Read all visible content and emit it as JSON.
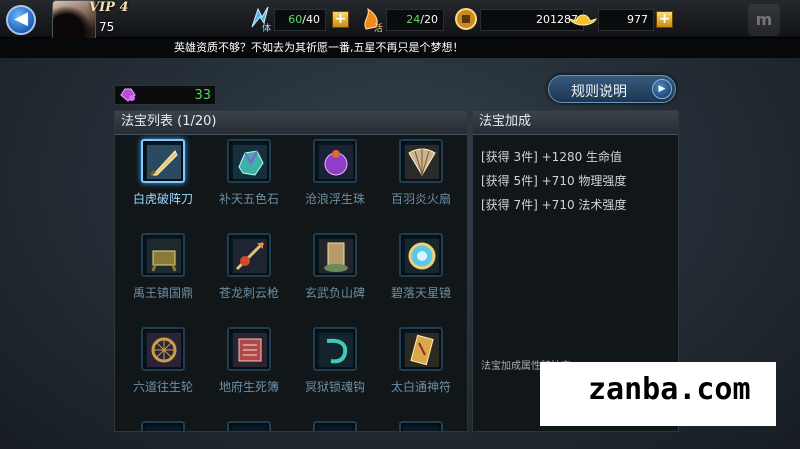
{
  "header": {
    "vip": "VIP 4",
    "level": "75",
    "stamina": {
      "current": "60",
      "max": "/40"
    },
    "energy": {
      "current": "24",
      "max": "/20"
    },
    "coins": "201287",
    "gold": "977",
    "plus": "+"
  },
  "marquee": "英雄资质不够？不如去为其祈愿一番,五星不再只是个梦想！",
  "gem_count": "33",
  "rules_label": "规则说明",
  "treasure_list": {
    "title": "法宝列表 (1/20)",
    "items": [
      {
        "name": "白虎破阵刀",
        "icon": "blade-icon",
        "selected": true
      },
      {
        "name": "补天五色石",
        "icon": "stone-icon",
        "selected": false
      },
      {
        "name": "沧浪浮生珠",
        "icon": "pearl-icon",
        "selected": false
      },
      {
        "name": "百羽炎火扇",
        "icon": "fan-icon",
        "selected": false
      },
      {
        "name": "禹王镇国鼎",
        "icon": "cauldron-icon",
        "selected": false
      },
      {
        "name": "苍龙刺云枪",
        "icon": "spear-icon",
        "selected": false
      },
      {
        "name": "玄武负山碑",
        "icon": "stele-icon",
        "selected": false
      },
      {
        "name": "碧落天星镜",
        "icon": "mirror-icon",
        "selected": false
      },
      {
        "name": "六道往生轮",
        "icon": "wheel-icon",
        "selected": false
      },
      {
        "name": "地府生死簿",
        "icon": "book-icon",
        "selected": false
      },
      {
        "name": "冥狱锁魂钩",
        "icon": "hook-icon",
        "selected": false
      },
      {
        "name": "太白通神符",
        "icon": "talisman-icon",
        "selected": false
      }
    ]
  },
  "bonus": {
    "title": "法宝加成",
    "lines": [
      "[获得 3件] +1280 生命值",
      "[获得 5件] +710 物理强度",
      "[获得 7件] +710 法术强度"
    ],
    "note": "法宝加成属性随法宝"
  },
  "watermark": "zanba.com"
}
